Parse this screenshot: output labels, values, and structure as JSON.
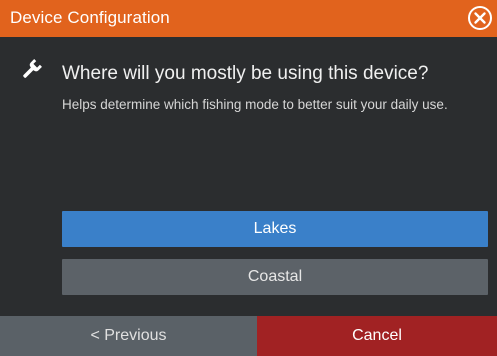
{
  "dialog": {
    "title": "Device Configuration",
    "close_icon": "close-circle-icon"
  },
  "prompt": {
    "icon": "wrench-icon",
    "question": "Where will you mostly be using this device?",
    "help": "Helps determine which fishing mode to better suit your daily use."
  },
  "options": [
    {
      "label": "Lakes",
      "selected": true
    },
    {
      "label": "Coastal",
      "selected": false
    }
  ],
  "footer": {
    "previous_label": "< Previous",
    "cancel_label": "Cancel"
  },
  "colors": {
    "titlebar": "#e1631d",
    "background": "#2b2d2f",
    "selected_option": "#3a80c9",
    "option": "#5c6268",
    "previous_button": "#5a6167",
    "cancel_button": "#a12223"
  }
}
